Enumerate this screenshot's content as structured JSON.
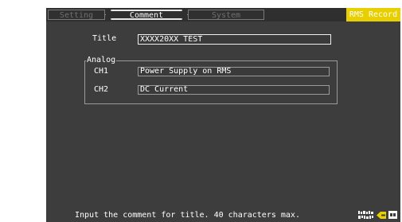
{
  "tabs": [
    {
      "label": "Setting",
      "active": false
    },
    {
      "label": "Comment",
      "active": true
    },
    {
      "label": "System",
      "active": false
    }
  ],
  "badge": {
    "label": "RMS Record",
    "color": "#e8cf00"
  },
  "form": {
    "title_label": "Title",
    "title_value": "XXXX20XX TEST",
    "group_label": "Analog",
    "channels": [
      {
        "label": "CH1",
        "value": "Power Supply on RMS"
      },
      {
        "label": "CH2",
        "value": "DC Current"
      }
    ]
  },
  "status": {
    "message": "Input the comment for title. 40 characters max.",
    "icons": [
      "memory-status-icon",
      "key-lock-icon",
      "cf-card-icon"
    ]
  },
  "colors": {
    "panel_bg": "#3d3d3d",
    "accent": "#e8cf00"
  }
}
